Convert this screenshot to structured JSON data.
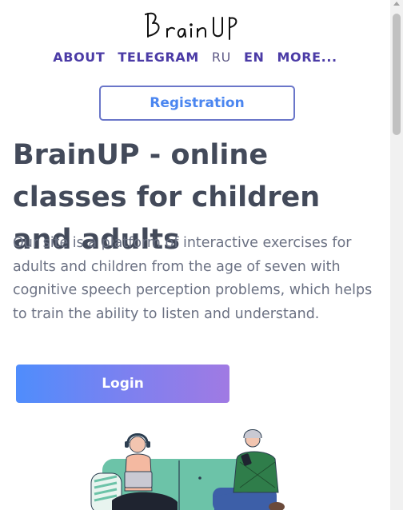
{
  "header": {
    "logo_text": "BrainUP"
  },
  "nav": {
    "items": [
      {
        "label": "ABOUT"
      },
      {
        "label": "TELEGRAM"
      },
      {
        "label": "RU"
      },
      {
        "label": "EN"
      },
      {
        "label": "MORE..."
      }
    ]
  },
  "registration": {
    "label": "Registration"
  },
  "hero": {
    "title": "BrainUP - online classes for children and adults",
    "description": "Our site is a platform of interactive exercises for adults and children from the age of seven with cognitive speech perception problems, which helps to train the ability to listen and understand."
  },
  "login": {
    "label": "Login"
  },
  "colors": {
    "nav": "#4b3ba6",
    "registration_border": "#6a76c9",
    "registration_text": "#4b86f0",
    "title": "#434a5a",
    "body_text": "#6b7183",
    "login_gradient_start": "#4f8dfc",
    "login_gradient_end": "#a07ae3"
  }
}
